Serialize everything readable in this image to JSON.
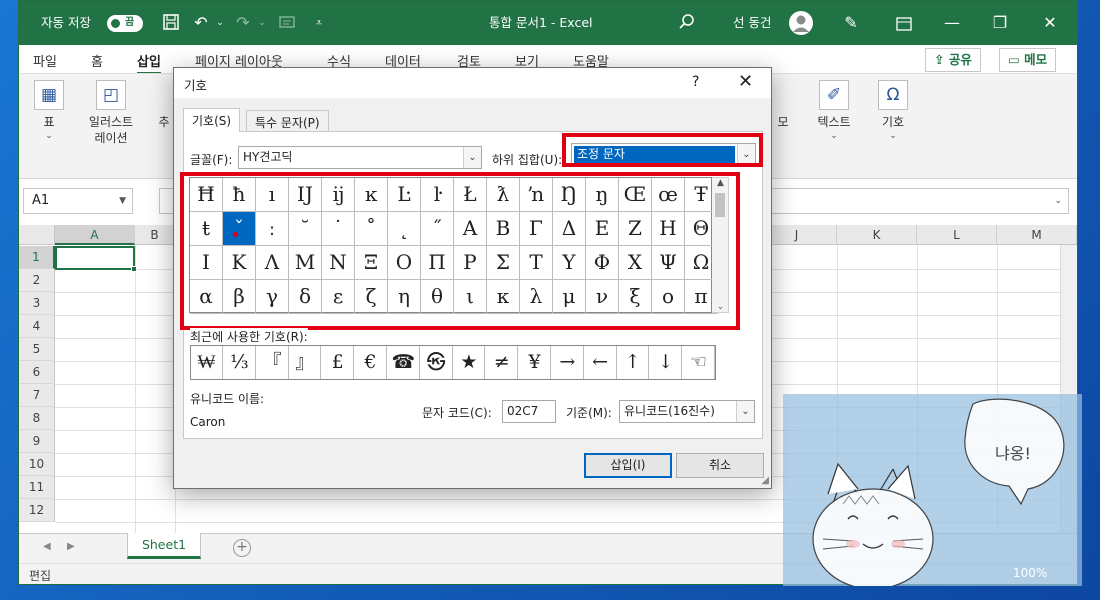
{
  "titlebar": {
    "autosave_label": "자동 저장",
    "autosave_state": "끔",
    "document_title": "통합 문서1 - Excel",
    "user_name": "선 동건",
    "icons": [
      "save-icon",
      "undo-icon",
      "redo-icon",
      "form-icon",
      "customize-icon",
      "search-icon",
      "pen-icon",
      "ribbon-display-icon",
      "minimize-icon",
      "maximize-icon",
      "close-icon"
    ]
  },
  "ribbon": {
    "tabs": [
      "파일",
      "홈",
      "삽입",
      "페이지 레이아웃",
      "수식",
      "데이터",
      "검토",
      "보기",
      "도움말"
    ],
    "active_tab": "삽입",
    "share_label": "공유",
    "comments_label": "메모",
    "groups": {
      "table": "표",
      "illustration_1": "일러스트",
      "illustration_2": "레이션",
      "recommend": "추",
      "text": "텍스트",
      "symbol": "기호",
      "partial": "모"
    }
  },
  "formula_bar": {
    "name_box": "A1"
  },
  "grid": {
    "columns": [
      "A",
      "B",
      "J",
      "K",
      "L",
      "M"
    ],
    "rows": [
      "1",
      "2",
      "3",
      "4",
      "5",
      "6",
      "7",
      "8",
      "9",
      "10",
      "11",
      "12"
    ]
  },
  "sheet_tab": "Sheet1",
  "status": {
    "mode": "편집",
    "zoom": "100%"
  },
  "dialog": {
    "title": "기호",
    "help": "?",
    "tabs": [
      "기호(S)",
      "특수 문자(P)"
    ],
    "font_label": "글꼴(F):",
    "font_value": "HY견고딕",
    "subset_label": "하위 집합(U):",
    "subset_value": "조정 문자",
    "symbols": [
      [
        "Ħ",
        "ħ",
        "ı",
        "Ĳ",
        "ĳ",
        "ĸ",
        "Ŀ",
        "ŀ",
        "Ł",
        "ƛ",
        "ŉ",
        "Ŋ",
        "ŋ",
        "Œ",
        "œ",
        "Ŧ"
      ],
      [
        "ŧ",
        "ˇ",
        "ː",
        "˘",
        "˙",
        "˚",
        "˛",
        "˝",
        "Α",
        "Β",
        "Γ",
        "Δ",
        "Ε",
        "Ζ",
        "Η",
        "Θ"
      ],
      [
        "Ι",
        "Κ",
        "Λ",
        "Μ",
        "Ν",
        "Ξ",
        "Ο",
        "Π",
        "Ρ",
        "Σ",
        "Τ",
        "Υ",
        "Φ",
        "Χ",
        "Ψ",
        "Ω"
      ],
      [
        "α",
        "β",
        "γ",
        "δ",
        "ε",
        "ζ",
        "η",
        "θ",
        "ι",
        "κ",
        "λ",
        "μ",
        "ν",
        "ξ",
        "ο",
        "π"
      ]
    ],
    "recent_label": "최근에 사용한 기호(R):",
    "recent": [
      "₩",
      "⅓",
      "『",
      "』",
      "£",
      "€",
      "☎",
      "㉿",
      "★",
      "≠",
      "¥",
      "→",
      "←",
      "↑",
      "↓",
      "☜"
    ],
    "unicode_name_label": "유니코드 이름:",
    "unicode_name": "Caron",
    "char_code_label": "문자 코드(C):",
    "char_code": "02C7",
    "from_label": "기준(M):",
    "from_value": "유니코드(16진수)",
    "insert_label": "삽입(I)",
    "cancel_label": "취소"
  },
  "cat_overlay": {
    "speech": "냐옹!"
  },
  "colors": {
    "excel_green": "#217346",
    "highlight": "#0067c0",
    "annotation_red": "#e00012"
  }
}
